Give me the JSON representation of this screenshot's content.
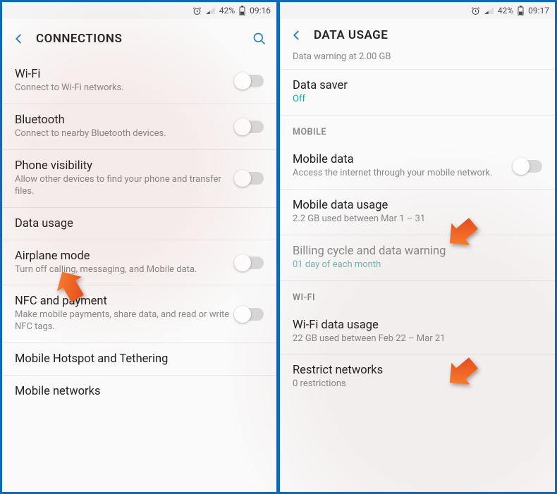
{
  "left": {
    "status": {
      "battery": "42%",
      "time": "09:16"
    },
    "header": {
      "title": "CONNECTIONS"
    },
    "items": [
      {
        "title": "Wi-Fi",
        "sub": "Connect to Wi-Fi networks.",
        "toggle": true
      },
      {
        "title": "Bluetooth",
        "sub": "Connect to nearby Bluetooth devices.",
        "toggle": true
      },
      {
        "title": "Phone visibility",
        "sub": "Allow other devices to find your phone and transfer files.",
        "toggle": true
      },
      {
        "title": "Data usage",
        "sub": "",
        "toggle": false
      },
      {
        "title": "Airplane mode",
        "sub": "Turn off calling, messaging, and Mobile data.",
        "toggle": true
      },
      {
        "title": "NFC and payment",
        "sub": "Make mobile payments, share data, and read or write NFC tags.",
        "toggle": true
      },
      {
        "title": "Mobile Hotspot and Tethering",
        "sub": "",
        "toggle": false
      },
      {
        "title": "Mobile networks",
        "sub": "",
        "toggle": false
      }
    ]
  },
  "right": {
    "status": {
      "battery": "42%",
      "time": "09:17"
    },
    "header": {
      "title": "DATA USAGE"
    },
    "sub_header": "Data warning at 2.00 GB",
    "data_saver": {
      "title": "Data saver",
      "value": "Off"
    },
    "sections": {
      "mobile": "MOBILE",
      "wifi": "WI-FI"
    },
    "items": {
      "mobile_data": {
        "title": "Mobile data",
        "sub": "Access the internet through your mobile network."
      },
      "mobile_data_usage": {
        "title": "Mobile data usage",
        "sub": "2.2 GB used between Mar 1 – 31"
      },
      "billing": {
        "title": "Billing cycle and data warning",
        "sub": "01 day of each month"
      },
      "wifi_usage": {
        "title": "Wi-Fi data usage",
        "sub": "22 GB used between Feb 22 – Mar 21"
      },
      "restrict": {
        "title": "Restrict networks",
        "sub": "0 restrictions"
      }
    }
  },
  "icons": {
    "alarm": "⏰",
    "signal": "▮",
    "battery": "▮"
  }
}
